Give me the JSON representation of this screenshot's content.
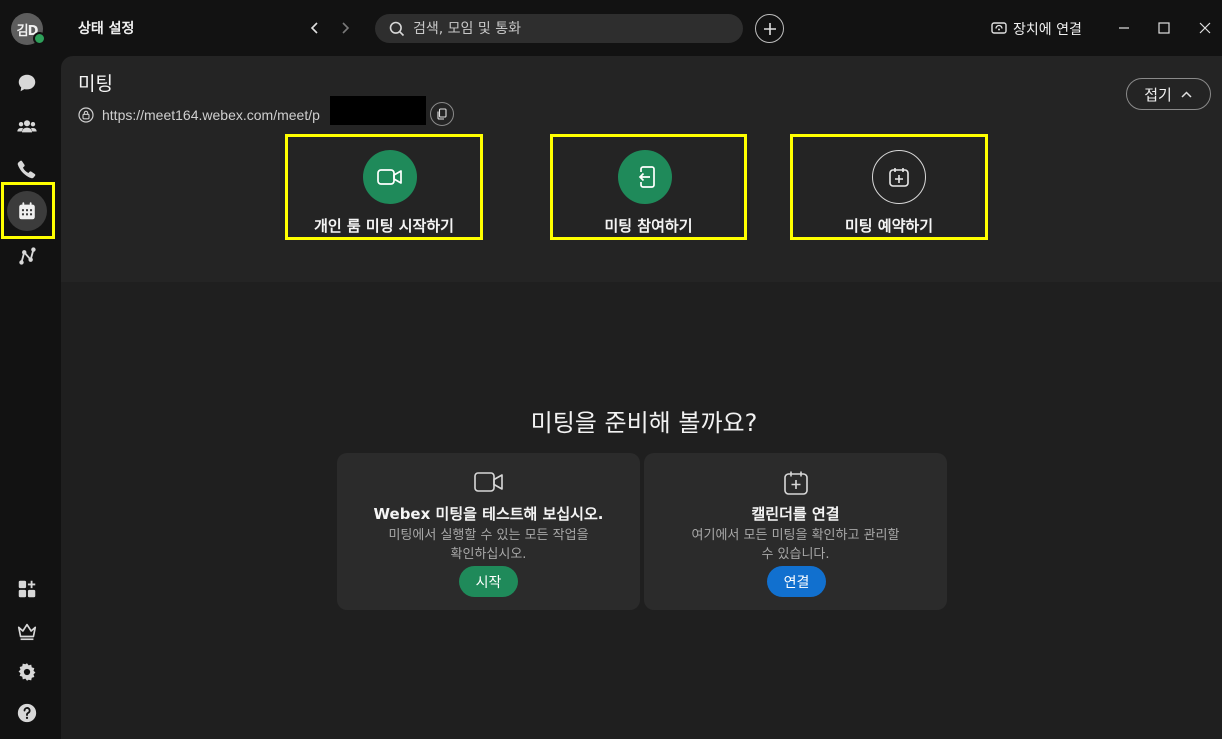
{
  "user": {
    "initials": "김D",
    "presence": "available"
  },
  "header": {
    "status_label": "상태 설정",
    "search_placeholder": "검색, 모임 및 통화",
    "connect_device": "장치에 연결"
  },
  "nav": {
    "items": [
      {
        "name": "messaging",
        "icon": "chat-bubble-icon"
      },
      {
        "name": "teams",
        "icon": "people-icon"
      },
      {
        "name": "calling",
        "icon": "phone-icon"
      },
      {
        "name": "meetings",
        "icon": "calendar-icon",
        "active": true
      },
      {
        "name": "connections",
        "icon": "share-nodes-icon"
      }
    ],
    "bottom_items": [
      {
        "name": "apps",
        "icon": "apps-add-icon"
      },
      {
        "name": "upgrade",
        "icon": "crown-icon"
      },
      {
        "name": "settings",
        "icon": "gear-icon"
      },
      {
        "name": "help",
        "icon": "help-circle-icon"
      }
    ]
  },
  "meetings": {
    "title": "미팅",
    "url_text": "https://meet164.webex.com/meet/p",
    "collapse_label": "접기",
    "actions": [
      {
        "label": "개인 룸 미팅 시작하기",
        "icon": "video-camera-icon"
      },
      {
        "label": "미팅 참여하기",
        "icon": "join-door-icon"
      },
      {
        "label": "미팅 예약하기",
        "icon": "calendar-plus-icon"
      }
    ]
  },
  "ready": {
    "title": "미팅을 준비해 볼까요?",
    "cards": [
      {
        "icon": "video-camera-icon",
        "title_bold": "Webex",
        "title_rest": " 미팅을 테스트해 보십시오.",
        "desc_line1": "미팅에서 실행할 수 있는 모든 작업을",
        "desc_line2": "확인하십시오.",
        "button": "시작"
      },
      {
        "icon": "calendar-plus-icon",
        "title": "캘린더를 연결",
        "desc_line1": "여기에서 모든 미팅을 확인하고 관리할",
        "desc_line2": "수 있습니다.",
        "button": "연결"
      }
    ]
  },
  "colors": {
    "accent_green": "#1f8a5a",
    "connect_blue": "#1170cf",
    "highlight": "#ffff00"
  }
}
